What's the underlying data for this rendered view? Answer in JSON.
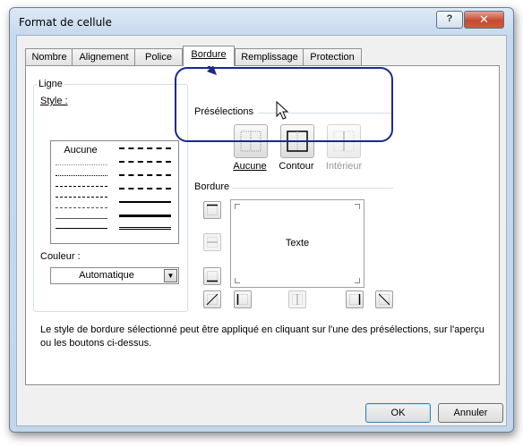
{
  "window": {
    "title": "Format de cellule",
    "help_label": "?",
    "close_label": "✕"
  },
  "tabs": [
    {
      "label": "Nombre"
    },
    {
      "label": "Alignement"
    },
    {
      "label": "Police"
    },
    {
      "label": "Bordure",
      "active": true
    },
    {
      "label": "Remplissage"
    },
    {
      "label": "Protection"
    }
  ],
  "line_group": {
    "legend": "Ligne",
    "style_label": "Style :",
    "none_label": "Aucune",
    "color_label": "Couleur :",
    "color_value": "Automatique"
  },
  "presets": {
    "legend": "Présélections",
    "none": "Aucune",
    "outline": "Contour",
    "inside": "Intérieur"
  },
  "border": {
    "legend": "Bordure",
    "preview_text": "Texte"
  },
  "description": "Le style de bordure sélectionné peut être appliqué en cliquant sur l'une des présélections, sur l'aperçu ou les boutons ci-dessus.",
  "buttons": {
    "ok": "OK",
    "cancel": "Annuler"
  },
  "colors": {
    "annotation": "#1a2a8c",
    "accent": "#3c7fb1"
  }
}
